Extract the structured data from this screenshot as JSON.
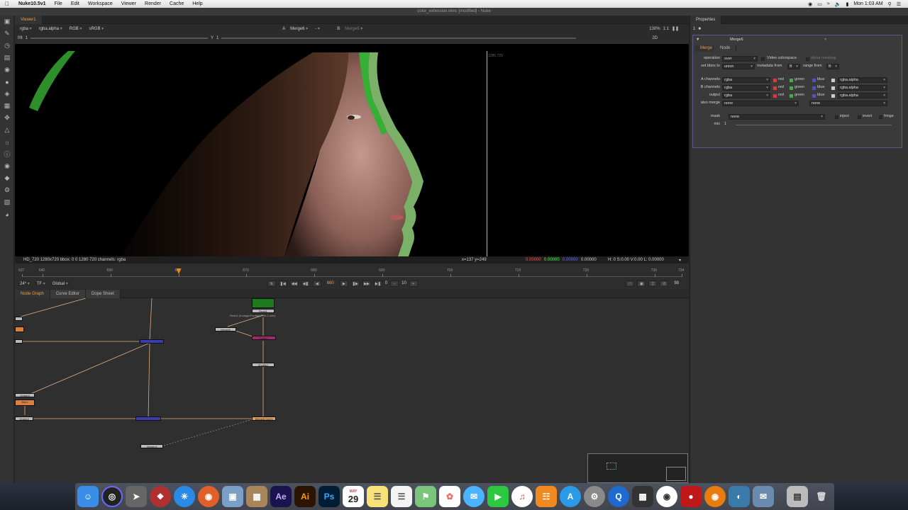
{
  "menubar": {
    "app_name": "Nuke10.5v1",
    "items": [
      "File",
      "Edit",
      "Workspace",
      "Viewer",
      "Render",
      "Cache",
      "Help"
    ],
    "clock": "Mon 1:03 AM"
  },
  "window_title": "color_extension.nknc [modified] - Nuke",
  "viewer": {
    "tab_label": "Viewer1",
    "channels": "rgba",
    "alpha_channel": "rgba.alpha",
    "colorspace_mode": "RGB",
    "lut": "sRGB",
    "input_a_label": "A",
    "input_a": "Merge6",
    "wipe": "-",
    "input_b_label": "B",
    "input_b": "Merge6",
    "gain_label": "f/8",
    "gain_value": "1",
    "gamma_label": "Y",
    "gamma_value": "1",
    "zoom": "130%",
    "proxy": "1:1",
    "view_mode": "2D",
    "format_label": "1280,720",
    "info_text": "HD_720 1280x720  bbox: 0 0 1280 720 channels: rgba",
    "cursor_pos": "x=137 y=249",
    "pixel_values": [
      "0.00000",
      "0.00000",
      "0.00000",
      "0.00000"
    ],
    "hsv_text": "H:  0 S:0.00 V:0.00   L: 0.00000"
  },
  "timeline": {
    "start": "637",
    "end": "734",
    "ticks": [
      "637",
      "640",
      "650",
      "660",
      "670",
      "680",
      "690",
      "700",
      "710",
      "720",
      "730",
      "734"
    ],
    "current_frame_marker": "660",
    "fps": "24*",
    "tf": "TF",
    "global": "Global",
    "current_frame": "660",
    "step": "10",
    "zero": "0",
    "end_field": "98"
  },
  "graph": {
    "tabs": [
      "Node Graph",
      "Curve Editor",
      "Dope Sheet"
    ],
    "active_tab": "Node Graph",
    "nodes": {
      "read": "Read1",
      "read_caption": "Read1 (footage/Footage/File-1.mov)",
      "merge_top": "Merge5",
      "grade1": "Grade1",
      "shuffle": "Shuffle2",
      "grade2": "Grade2",
      "merge6": "Merge6 (over)",
      "viewer": "Viewer1",
      "left_a": "Grade3",
      "left_b": "Blur1",
      "left_c": "Grade4"
    }
  },
  "properties": {
    "tab_label": "Properties",
    "max_panels": "1",
    "node_name": "Merge6",
    "subtabs": [
      "Merge",
      "Node"
    ],
    "operation_label": "operation",
    "operation_value": "over",
    "video_colorspace": "Video colorspace",
    "alpha_masking": "alpha masking",
    "set_bbox_label": "set bbox to",
    "set_bbox_value": "union",
    "metadata_label": "metadata from",
    "metadata_value": "B",
    "range_label": "range from",
    "range_value": "B",
    "a_channels_label": "A channels",
    "b_channels_label": "B channels",
    "output_label": "output",
    "channels_value": "rgba",
    "alpha_value": "rgba.alpha",
    "red": "red",
    "green": "green",
    "blue": "blue",
    "also_merge_label": "also merge",
    "also_merge_value": "none",
    "also_merge_value2": "none",
    "mask_label": "mask",
    "mask_value": "none",
    "inject": "inject",
    "invert": "invert",
    "fringe": "fringe",
    "mix_label": "mix",
    "mix_value": "1"
  },
  "dock": {
    "items": [
      "finder",
      "siri",
      "launchpad",
      "davinci",
      "safari",
      "firefox",
      "preview",
      "archive",
      "after-effects",
      "illustrator",
      "photoshop",
      "calendar",
      "notes",
      "reminders",
      "maps",
      "photos",
      "messages",
      "facetime",
      "itunes",
      "ibooks",
      "app-store",
      "system-prefs",
      "quicktime",
      "final-cut",
      "chrome",
      "nuke",
      "blender",
      "photos-2",
      "mail",
      "files",
      "trash"
    ],
    "calendar_month": "MAY",
    "calendar_day": "29",
    "ae_label": "Ae",
    "ai_label": "Ai",
    "ps_label": "Ps"
  }
}
